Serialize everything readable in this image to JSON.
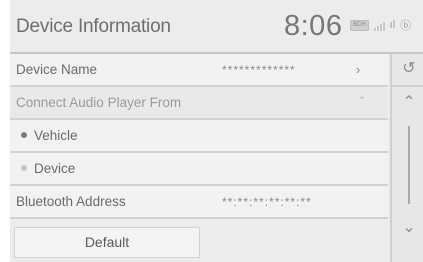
{
  "header": {
    "title": "Device Information",
    "clock": "8:06",
    "badge": "BCH",
    "status_glyph_1": "ıl",
    "status_glyph_2": "ⓑ"
  },
  "rows": {
    "device_name": {
      "label": "Device Name",
      "value": "*************"
    },
    "connect_from": {
      "label": "Connect Audio Player From"
    },
    "vehicle": {
      "label": "Vehicle",
      "selected": true
    },
    "device": {
      "label": "Device",
      "selected": false
    },
    "bt_address": {
      "label": "Bluetooth Address",
      "value": "**:**:**:**:**:**"
    }
  },
  "buttons": {
    "default_label": "Default"
  },
  "icons": {
    "row_chevron": "chevron-right-icon",
    "section_chevron": "chevron-up-icon",
    "back": "back-arrow-icon",
    "scroll_up": "double-chevron-up-icon",
    "scroll_down": "double-chevron-down-icon"
  },
  "colors": {
    "background": "#ececec",
    "row": "#f2f2f2",
    "separator": "#d2d2d2"
  }
}
